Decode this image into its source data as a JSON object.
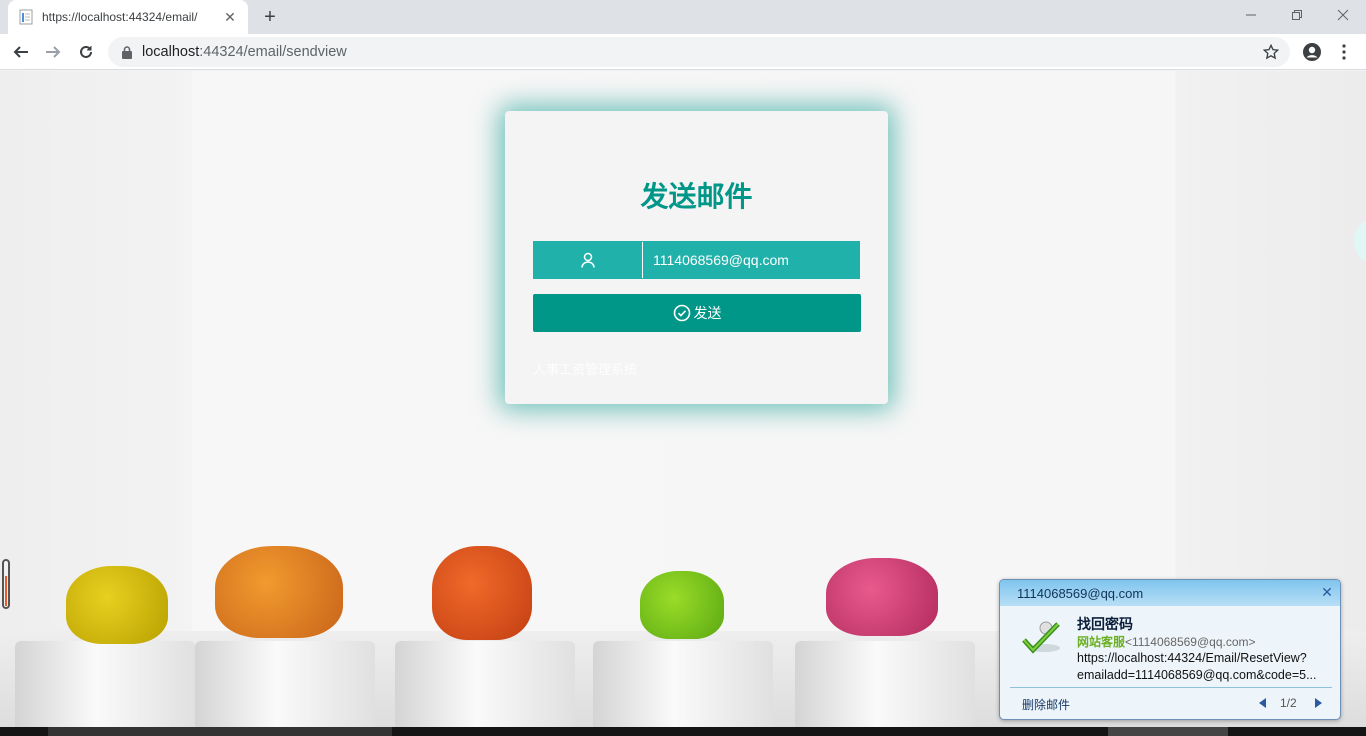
{
  "browser": {
    "tab_title": "https://localhost:44324/email/",
    "url_host": "localhost",
    "url_path": ":44324/email/sendview"
  },
  "form": {
    "title": "发送邮件",
    "email_value": "1114068569@qq.com",
    "send_label": "发送",
    "footer_text": "人事工资管理系统"
  },
  "notification": {
    "header_email": "1114068569@qq.com",
    "subject": "找回密码",
    "sender_name": "网站客服",
    "sender_addr": "<1114068569@qq.com>",
    "line1": "https://localhost:44324/Email/ResetView?",
    "line2": "emailadd=1114068569@qq.com&code=5...",
    "delete_label": "删除邮件",
    "page_indicator": "1/2"
  },
  "colors": {
    "accent": "#009688",
    "input_bg": "#20b2aa"
  }
}
